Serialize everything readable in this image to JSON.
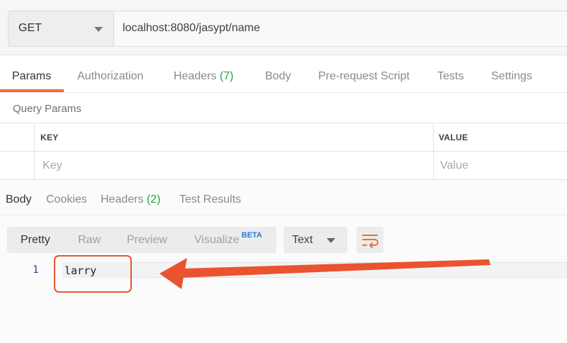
{
  "request": {
    "method": "GET",
    "url": "localhost:8080/jasypt/name"
  },
  "request_tabs": [
    {
      "label": "Params",
      "count": ""
    },
    {
      "label": "Authorization",
      "count": ""
    },
    {
      "label": "Headers",
      "count": "(7)"
    },
    {
      "label": "Body",
      "count": ""
    },
    {
      "label": "Pre-request Script",
      "count": ""
    },
    {
      "label": "Tests",
      "count": ""
    },
    {
      "label": "Settings",
      "count": ""
    }
  ],
  "query_params": {
    "title": "Query Params",
    "key_header": "KEY",
    "value_header": "VALUE",
    "key_placeholder": "Key",
    "value_placeholder": "Value"
  },
  "response_tabs": [
    {
      "label": "Body",
      "count": ""
    },
    {
      "label": "Cookies",
      "count": ""
    },
    {
      "label": "Headers",
      "count": "(2)"
    },
    {
      "label": "Test Results",
      "count": ""
    }
  ],
  "view_modes": {
    "pretty": "Pretty",
    "raw": "Raw",
    "preview": "Preview",
    "visualize": "Visualize",
    "beta": "BETA"
  },
  "format": "Text",
  "editor": {
    "line_number": "1",
    "content": "larry"
  },
  "colors": {
    "accent": "#f26b3a",
    "count_green": "#27a14a",
    "annotation": "#ea5330"
  }
}
